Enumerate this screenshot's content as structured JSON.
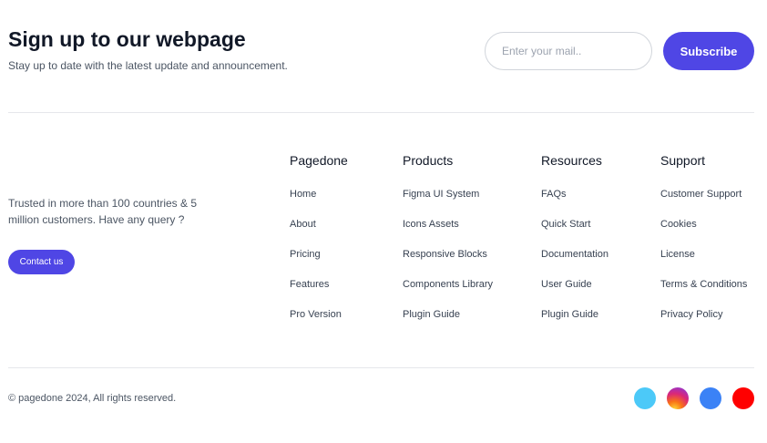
{
  "newsletter": {
    "title": "Sign up to our webpage",
    "subtitle": "Stay up to date with the latest update and announcement.",
    "email_placeholder": "Enter your mail..",
    "subscribe_label": "Subscribe"
  },
  "brand": {
    "description": "Trusted in more than 100 countries & 5 million customers. Have any query ?",
    "contact_label": "Contact us"
  },
  "columns": [
    {
      "title": "Pagedone",
      "links": [
        "Home",
        "About",
        "Pricing",
        "Features",
        "Pro Version"
      ]
    },
    {
      "title": "Products",
      "links": [
        "Figma UI System",
        "Icons Assets",
        "Responsive Blocks",
        "Components Library",
        "Plugin Guide"
      ]
    },
    {
      "title": "Resources",
      "links": [
        "FAQs",
        "Quick Start",
        "Documentation",
        "User Guide",
        "Plugin Guide"
      ]
    },
    {
      "title": "Support",
      "links": [
        "Customer Support",
        "Cookies",
        "License",
        "Terms & Conditions",
        "Privacy Policy"
      ]
    }
  ],
  "footer": {
    "copyright": "© pagedone 2024, All rights reserved.",
    "social": [
      "twitter-icon",
      "instagram-icon",
      "facebook-icon",
      "youtube-icon"
    ]
  },
  "colors": {
    "accent": "#4f46e5",
    "twitter": "#4cc9f8",
    "facebook": "#3b82f6",
    "youtube": "#ff0000"
  }
}
